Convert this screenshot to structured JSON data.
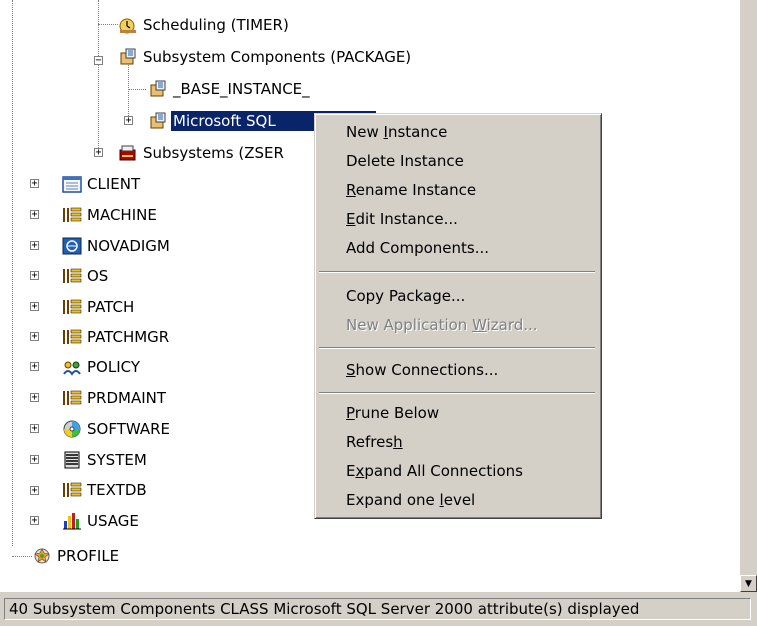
{
  "tree": {
    "items": [
      {
        "label": "Scheduling (TIMER)",
        "icon": "scheduling-icon"
      },
      {
        "label": "Subsystem Components (PACKAGE)",
        "icon": "package-icon"
      },
      {
        "label": "_BASE_INSTANCE_",
        "icon": "package-icon"
      },
      {
        "label": "Microsoft SQL",
        "icon": "package-icon"
      },
      {
        "label": "Subsystems (ZSER",
        "icon": "subsystems-icon"
      },
      {
        "label": "CLIENT",
        "icon": "client-icon"
      },
      {
        "label": "MACHINE",
        "icon": "class-icon"
      },
      {
        "label": "NOVADIGM",
        "icon": "novadigm-icon"
      },
      {
        "label": "OS",
        "icon": "class-icon"
      },
      {
        "label": "PATCH",
        "icon": "class-icon"
      },
      {
        "label": "PATCHMGR",
        "icon": "class-icon"
      },
      {
        "label": "POLICY",
        "icon": "policy-icon"
      },
      {
        "label": "PRDMAINT",
        "icon": "class-icon"
      },
      {
        "label": "SOFTWARE",
        "icon": "software-icon"
      },
      {
        "label": "SYSTEM",
        "icon": "system-icon"
      },
      {
        "label": "TEXTDB",
        "icon": "class-icon"
      },
      {
        "label": "USAGE",
        "icon": "usage-icon"
      },
      {
        "label": "PROFILE",
        "icon": "profile-icon"
      }
    ],
    "selected": "Microsoft SQL"
  },
  "context_menu": {
    "items": [
      {
        "pre": "New ",
        "u": "I",
        "post": "nstance",
        "enabled": true
      },
      {
        "pre": "Delete Instance",
        "u": "",
        "post": "",
        "enabled": true
      },
      {
        "pre": "",
        "u": "R",
        "post": "ename Instance",
        "enabled": true
      },
      {
        "pre": "",
        "u": "E",
        "post": "dit Instance...",
        "enabled": true
      },
      {
        "pre": "Add Components...",
        "u": "",
        "post": "",
        "enabled": true
      },
      {
        "pre": "Copy Package...",
        "u": "",
        "post": "",
        "enabled": true
      },
      {
        "pre": "New Application ",
        "u": "W",
        "post": "izard...",
        "enabled": false
      },
      {
        "pre": "",
        "u": "S",
        "post": "how Connections...",
        "enabled": true
      },
      {
        "pre": "",
        "u": "P",
        "post": "rune Below",
        "enabled": true
      },
      {
        "pre": "Refres",
        "u": "h",
        "post": "",
        "enabled": true
      },
      {
        "pre": "E",
        "u": "x",
        "post": "pand All Connections",
        "enabled": true
      },
      {
        "pre": "Expand one ",
        "u": "l",
        "post": "evel",
        "enabled": true
      }
    ]
  },
  "statusbar": {
    "text": "40 Subsystem Components CLASS Microsoft SQL Server 2000 attribute(s) displayed"
  },
  "scrollbar": {
    "down_arrow": "▼"
  },
  "expander": {
    "plus": "+",
    "minus": "−"
  }
}
